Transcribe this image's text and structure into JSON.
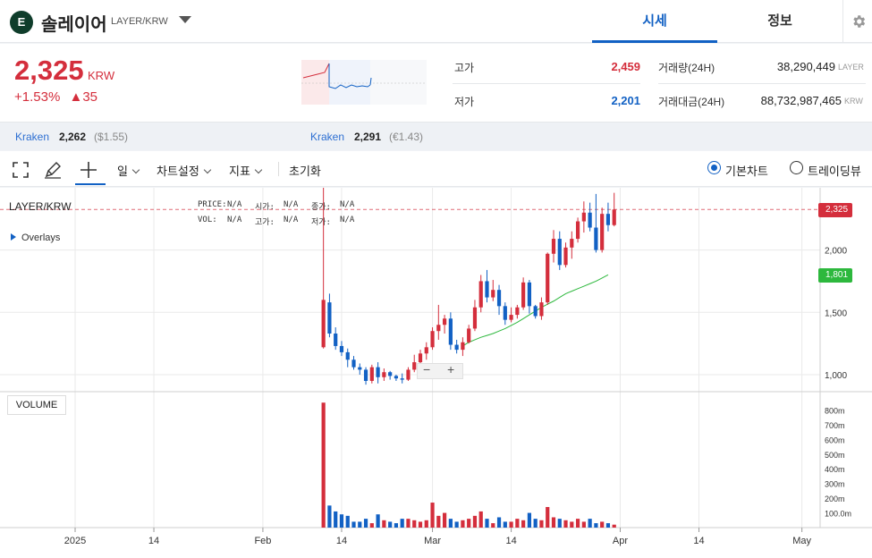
{
  "header": {
    "coin_name": "솔레이어",
    "pair": "LAYER/KRW",
    "tabs": [
      {
        "label": "시세",
        "active": true
      },
      {
        "label": "정보",
        "active": false
      }
    ],
    "logo_color": "#0f3d2b"
  },
  "summary": {
    "price": "2,325",
    "unit": "KRW",
    "change_pct": "+1.53%",
    "change_amt": "▲35",
    "high_label": "고가",
    "high_value": "2,459",
    "low_label": "저가",
    "low_value": "2,201",
    "vol_label": "거래량(24H)",
    "vol_value": "38,290,449",
    "vol_unit": "LAYER",
    "amt_label": "거래대금(24H)",
    "amt_value": "88,732,987,465",
    "amt_unit": "KRW",
    "up_color": "#d42e3c",
    "down_color": "#1261c4"
  },
  "exchanges": [
    {
      "name": "Kraken",
      "price": "2,262",
      "sub": "($1.55)"
    },
    {
      "name": "Kraken",
      "price": "2,291",
      "sub": "(€1.43)"
    }
  ],
  "toolbar": {
    "interval": "일",
    "chart_settings": "차트설정",
    "indicators": "지표",
    "reset": "초기화",
    "view_basic": "기본차트",
    "view_tradingview": "트레이딩뷰"
  },
  "chart": {
    "pair": "LAYER/KRW",
    "overlays": "Overlays",
    "legend": {
      "price_label": "PRICE:",
      "price_val": "N/A",
      "open_label": "시가:",
      "open_val": "N/A",
      "close_label": "종가:",
      "close_val": "N/A",
      "vol_label": "VOL:",
      "vol_val": "N/A",
      "high_label": "고가:",
      "high_val": "N/A",
      "low_label": "저가:",
      "low_val": "N/A"
    },
    "volume_label": "VOLUME",
    "zoom_minus": "−",
    "zoom_plus": "+",
    "current_price_tag": "2,325",
    "ma_tag": "1,801",
    "ma_color": "#2db83d"
  },
  "chart_data": {
    "type": "candlestick",
    "price_ticks": [
      "2,000",
      "1,500",
      "1,000"
    ],
    "price_tick_values": [
      2000,
      1500,
      1000
    ],
    "volume_ticks": [
      "800m",
      "700m",
      "600m",
      "500m",
      "400m",
      "300m",
      "200m",
      "100.0m"
    ],
    "volume_tick_values": [
      800,
      700,
      600,
      500,
      400,
      300,
      200,
      100
    ],
    "x_labels": [
      "2025",
      "14",
      "Feb",
      "14",
      "Mar",
      "14",
      "Apr",
      "14",
      "May"
    ],
    "x_label_days": [
      0,
      13,
      31,
      44,
      59,
      72,
      90,
      103,
      120
    ],
    "first_candle_day": 41,
    "candles": [
      [
        1220,
        1600,
        1210,
        2500,
        850
      ],
      [
        1580,
        1330,
        1300,
        1650,
        150
      ],
      [
        1330,
        1230,
        1200,
        1380,
        110
      ],
      [
        1230,
        1180,
        1150,
        1270,
        90
      ],
      [
        1180,
        1120,
        1060,
        1210,
        80
      ],
      [
        1120,
        1060,
        1040,
        1150,
        40
      ],
      [
        1060,
        1040,
        1000,
        1090,
        40
      ],
      [
        1040,
        950,
        920,
        1060,
        60
      ],
      [
        950,
        1060,
        930,
        1080,
        30
      ],
      [
        1060,
        980,
        930,
        1100,
        90
      ],
      [
        980,
        1020,
        950,
        1050,
        50
      ],
      [
        1020,
        990,
        960,
        1030,
        40
      ],
      [
        990,
        970,
        950,
        1000,
        30
      ],
      [
        970,
        960,
        930,
        1010,
        60
      ],
      [
        960,
        1040,
        950,
        1060,
        60
      ],
      [
        1040,
        1100,
        1020,
        1160,
        50
      ],
      [
        1100,
        1170,
        1070,
        1200,
        40
      ],
      [
        1170,
        1220,
        1120,
        1260,
        50
      ],
      [
        1220,
        1350,
        1200,
        1380,
        170
      ],
      [
        1350,
        1400,
        1280,
        1560,
        80
      ],
      [
        1400,
        1450,
        1330,
        1480,
        100
      ],
      [
        1450,
        1240,
        1200,
        1500,
        60
      ],
      [
        1240,
        1200,
        1170,
        1280,
        40
      ],
      [
        1200,
        1260,
        1150,
        1300,
        50
      ],
      [
        1260,
        1370,
        1250,
        1400,
        60
      ],
      [
        1370,
        1540,
        1350,
        1600,
        80
      ],
      [
        1540,
        1750,
        1500,
        1800,
        110
      ],
      [
        1750,
        1620,
        1580,
        1840,
        60
      ],
      [
        1620,
        1680,
        1590,
        1760,
        30
      ],
      [
        1680,
        1550,
        1480,
        1720,
        70
      ],
      [
        1550,
        1440,
        1400,
        1580,
        40
      ],
      [
        1440,
        1480,
        1420,
        1540,
        40
      ],
      [
        1480,
        1540,
        1450,
        1560,
        60
      ],
      [
        1540,
        1740,
        1520,
        1780,
        50
      ],
      [
        1740,
        1550,
        1490,
        1760,
        100
      ],
      [
        1550,
        1470,
        1450,
        1560,
        60
      ],
      [
        1470,
        1580,
        1440,
        1620,
        50
      ],
      [
        1580,
        1970,
        1560,
        1980,
        140
      ],
      [
        1970,
        2090,
        1900,
        2160,
        70
      ],
      [
        2090,
        1880,
        1840,
        2150,
        60
      ],
      [
        1880,
        2020,
        1860,
        2060,
        50
      ],
      [
        2020,
        2090,
        1930,
        2150,
        40
      ],
      [
        2090,
        2230,
        2060,
        2260,
        60
      ],
      [
        2230,
        2300,
        2140,
        2390,
        40
      ],
      [
        2300,
        2180,
        2150,
        2380,
        60
      ],
      [
        2180,
        2000,
        1980,
        2450,
        30
      ],
      [
        2000,
        2290,
        1980,
        2340,
        40
      ],
      [
        2290,
        2200,
        2150,
        2380,
        30
      ],
      [
        2200,
        2325,
        2190,
        2459,
        20
      ]
    ],
    "ma": [
      [
        1230,
        23
      ],
      [
        1260,
        24
      ],
      [
        1280,
        25
      ],
      [
        1300,
        26
      ],
      [
        1315,
        27
      ],
      [
        1330,
        28
      ],
      [
        1350,
        29
      ],
      [
        1370,
        30
      ],
      [
        1395,
        31
      ],
      [
        1420,
        32
      ],
      [
        1450,
        33
      ],
      [
        1480,
        34
      ],
      [
        1510,
        35
      ],
      [
        1540,
        36
      ],
      [
        1565,
        37
      ],
      [
        1590,
        38
      ],
      [
        1620,
        39
      ],
      [
        1650,
        40
      ],
      [
        1670,
        41
      ],
      [
        1690,
        42
      ],
      [
        1710,
        43
      ],
      [
        1730,
        44
      ],
      [
        1750,
        45
      ],
      [
        1775,
        46
      ],
      [
        1801,
        47
      ]
    ]
  }
}
